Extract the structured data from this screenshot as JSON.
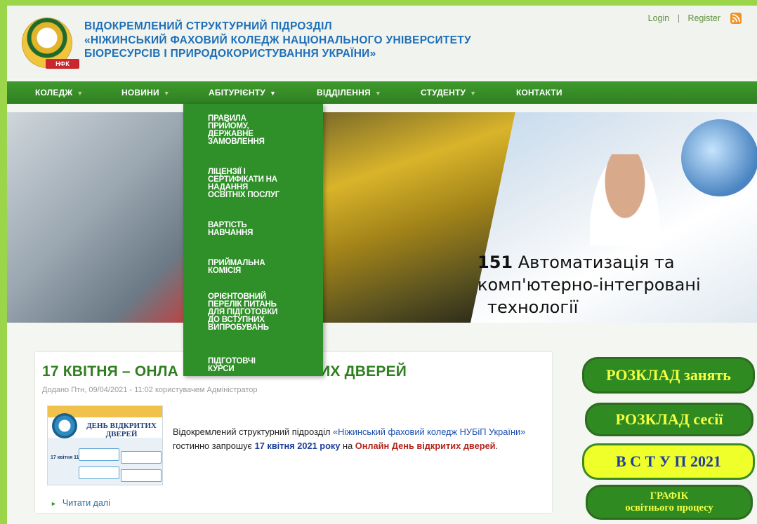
{
  "header": {
    "title_lines": [
      "ВІДОКРЕМЛЕНИЙ СТРУКТУРНИЙ ПІДРОЗДІЛ",
      "«НІЖИНСЬКИЙ ФАХОВИЙ КОЛЕДЖ НАЦІОНАЛЬНОГО УНІВЕРСИТЕТУ",
      "БІОРЕСУРСІВ І ПРИРОДОКОРИСТУВАННЯ УКРАЇНИ»"
    ],
    "logo_text": "НФК",
    "login": "Login",
    "separator": "|",
    "register": "Register",
    "rss_icon": "rss-icon"
  },
  "nav": {
    "items": [
      "КОЛЕДЖ",
      "НОВИНИ",
      "АБІТУРІЄНТУ",
      "ВІДДІЛЕННЯ",
      "СТУДЕНТУ",
      "КОНТАКТИ"
    ],
    "caret": "▼",
    "active": "АБІТУРІЄНТУ"
  },
  "dropdown": {
    "items": [
      [
        "ПРАВИЛА",
        "ПРИЙОМУ,",
        "ДЕРЖАВНЕ",
        "ЗАМОВЛЕННЯ"
      ],
      [
        "ЛІЦЕНЗІЇ І",
        "СЕРТИФІКАТИ НА",
        "НАДАННЯ",
        "ОСВІТНІХ ПОСЛУГ"
      ],
      [
        "ВАРТІСТЬ",
        "НАВЧАННЯ"
      ],
      [
        "ПРИЙМАЛЬНА",
        "КОМІСІЯ"
      ],
      [
        "ОРІЄНТОВНИЙ",
        "ПЕРЕЛІК ПИТАНЬ",
        "ДЛЯ ПІДГОТОВКИ",
        "ДО ВСТУПНИХ",
        "ВИПРОБУВАНЬ"
      ],
      [
        "ПІДГОТОВЧІ",
        "КУРСИ"
      ]
    ]
  },
  "banner": {
    "caption_number": "151",
    "caption_line1": "Автоматизація та",
    "caption_line2": "комп'ютерно-інтегровані",
    "caption_line3": "технології"
  },
  "article": {
    "title_left": "17 КВІТНЯ – ОНЛА",
    "title_right": "ТИХ ДВЕРЕЙ",
    "meta": "Додано Птн, 09/04/2021 - 11:02 користувачем Адміністратор",
    "thumb_title": "ДЕНЬ ВІДКРИТИХ ДВЕРЕЙ",
    "thumb_date": "17 квітня 11:00",
    "text_prefix": "Відокремлений структурний підрозділ ",
    "text_link": "«Ніжинський фаховий коледж НУБіП України»",
    "text_mid": " гостинно запрошує ",
    "text_date": "17 квітня 2021 року",
    "text_on": " на ",
    "text_event": "Онлайн День відкритих дверей",
    "text_end": ".",
    "read_more": "Читати далі"
  },
  "sidebar": {
    "buttons": [
      {
        "label": "РОЗКЛАД занять"
      },
      {
        "label": "РОЗКЛАД сесії"
      },
      {
        "label": "В С Т У П 2021"
      },
      {
        "line1": "ГРАФІК",
        "line2": "освітнього процесу"
      }
    ]
  },
  "colors": {
    "accent_green": "#2f8f29",
    "header_blue": "#1e6fb8",
    "button_yellow": "#efff2a"
  }
}
